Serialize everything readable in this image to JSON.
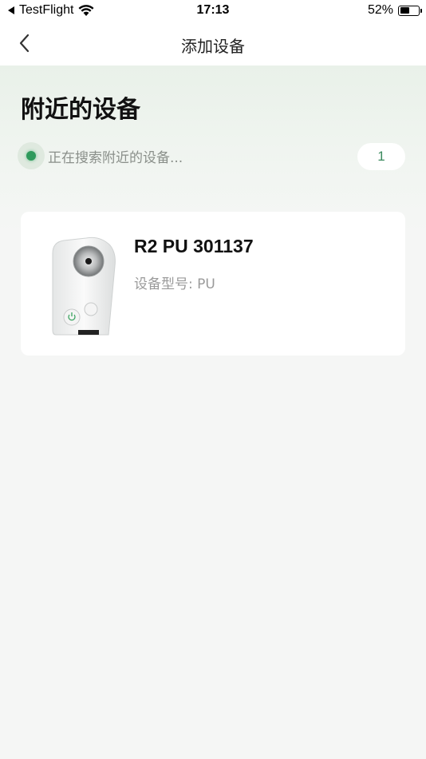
{
  "status_bar": {
    "back_app": "TestFlight",
    "time": "17:13",
    "battery_percent": "52%",
    "battery_level": 0.52
  },
  "nav": {
    "title": "添加设备"
  },
  "hero": {
    "title": "附近的设备",
    "searching_text": "正在搜索附近的设备...",
    "device_count": "1"
  },
  "devices": [
    {
      "name": "R2 PU 301137",
      "model_line": "设备型号: PU"
    }
  ],
  "colors": {
    "accent_green": "#2f9a5c",
    "count_text": "#3b8a5e"
  },
  "icons": [
    "back-arrow-icon",
    "wifi-icon",
    "battery-icon",
    "search-pulse-icon"
  ]
}
